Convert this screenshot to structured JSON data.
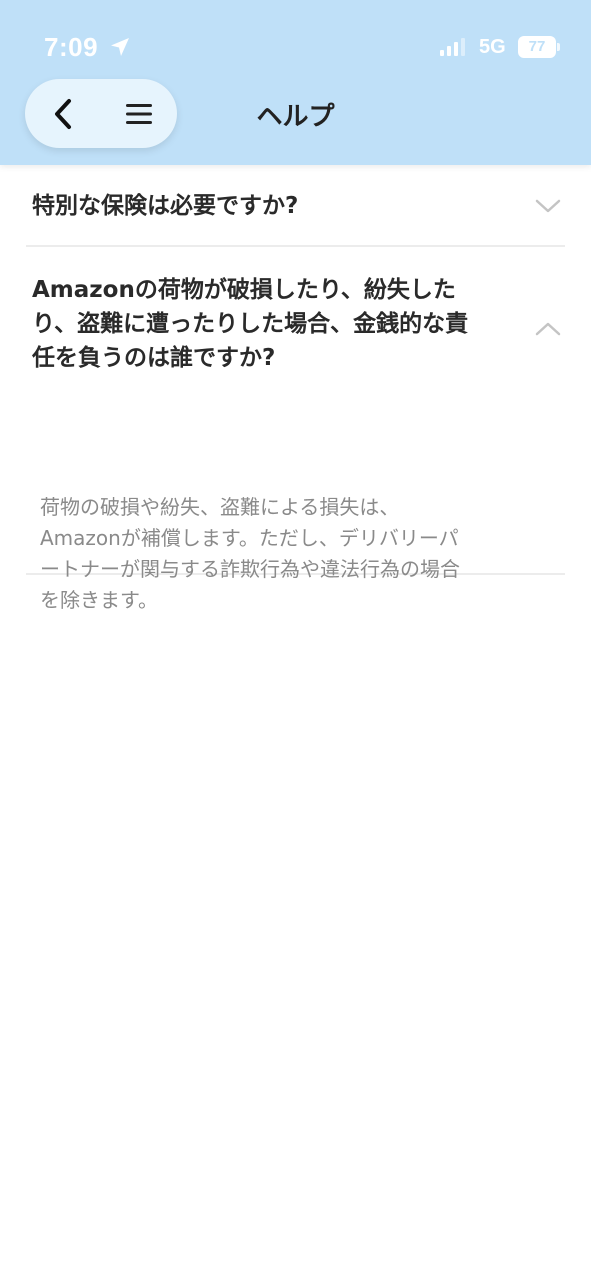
{
  "status_bar": {
    "time": "7:09",
    "network": "5G",
    "battery": "77"
  },
  "header": {
    "title": "ヘルプ",
    "background": "#bfe0f8"
  },
  "nav": {
    "back_icon": "chevron-left-icon",
    "menu_icon": "hamburger-menu-icon"
  },
  "faq": [
    {
      "question": "特別な保険は必要ですか?",
      "expanded": false,
      "icon": "chevron-down-icon"
    },
    {
      "question_lines": [
        "Amazonの荷物が破損したり、紛失した",
        "り、盗難に遭ったりした場合、金銭的な責",
        "任を負うのは誰ですか?"
      ],
      "expanded": true,
      "icon": "chevron-up-icon",
      "answer_lines": [
        "荷物の破損や紛失、盗難による損失は、",
        "Amazonが補償します。ただし、デリバリーパ",
        "ートナーが関与する詐欺行為や違法行為の場合",
        "を除きます。"
      ]
    }
  ]
}
